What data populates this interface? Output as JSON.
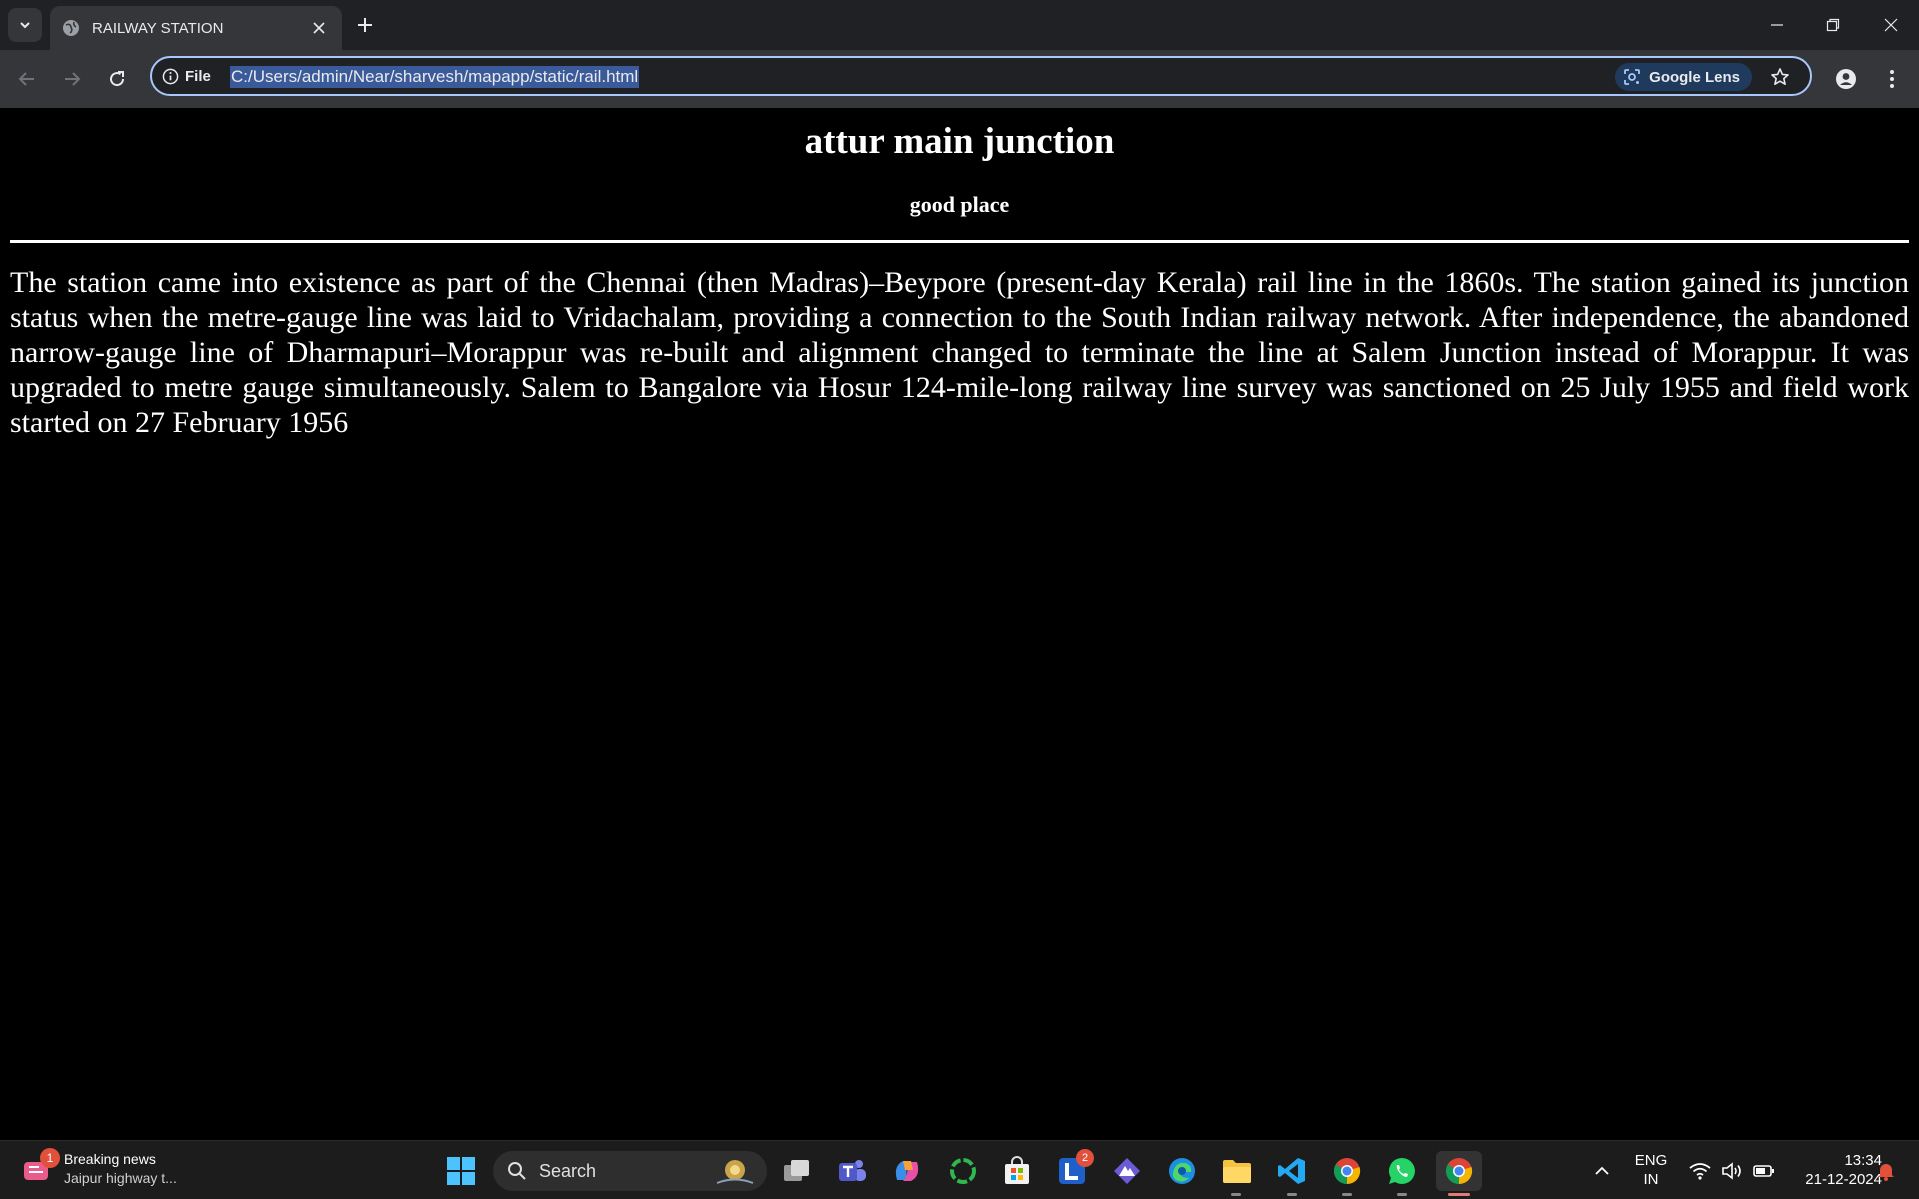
{
  "browser": {
    "tab": {
      "title": "RAILWAY STATION"
    },
    "address": {
      "scheme_label": "File",
      "url": "C:/Users/admin/Near/sharvesh/mapapp/static/rail.html"
    },
    "lens_label": "Google Lens"
  },
  "page": {
    "heading": "attur main junction",
    "subheading": "good place",
    "paragraph": "The station came into existence as part of the Chennai (then Madras)–Beypore (present-day Kerala) rail line in the 1860s. The station gained its junction status when the metre-gauge line was laid to Vridachalam, providing a connection to the South Indian railway network. After independence, the abandoned narrow-gauge line of Dharmapuri–Morappur was re-built and alignment changed to terminate the line at Salem Junction instead of Morappur. It was upgraded to metre gauge simultaneously. Salem to Bangalore via Hosur 124-mile-long railway line survey was sanctioned on 25 July 1955 and field work started on 27 February 1956"
  },
  "taskbar": {
    "news": {
      "title": "Breaking news",
      "subtitle": "Jaipur highway t...",
      "badge": "1"
    },
    "search_label": "Search",
    "app_badge": "2",
    "language": {
      "line1": "ENG",
      "line2": "IN"
    },
    "clock": {
      "time": "13:34",
      "date": "21-12-2024"
    }
  }
}
